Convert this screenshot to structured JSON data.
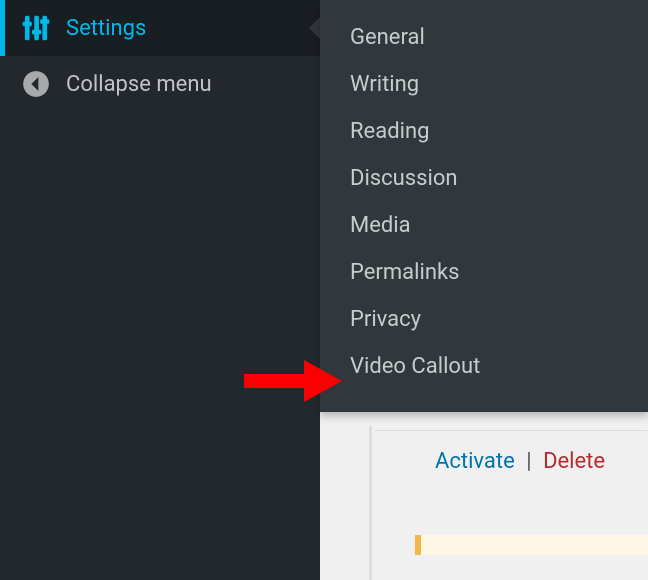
{
  "sidebar": {
    "settings_label": "Settings",
    "collapse_label": "Collapse menu"
  },
  "submenu": {
    "items": [
      "General",
      "Writing",
      "Reading",
      "Discussion",
      "Media",
      "Permalinks",
      "Privacy",
      "Video Callout"
    ]
  },
  "plugin_row": {
    "activate": "Activate",
    "separator": "|",
    "delete": "Delete"
  }
}
